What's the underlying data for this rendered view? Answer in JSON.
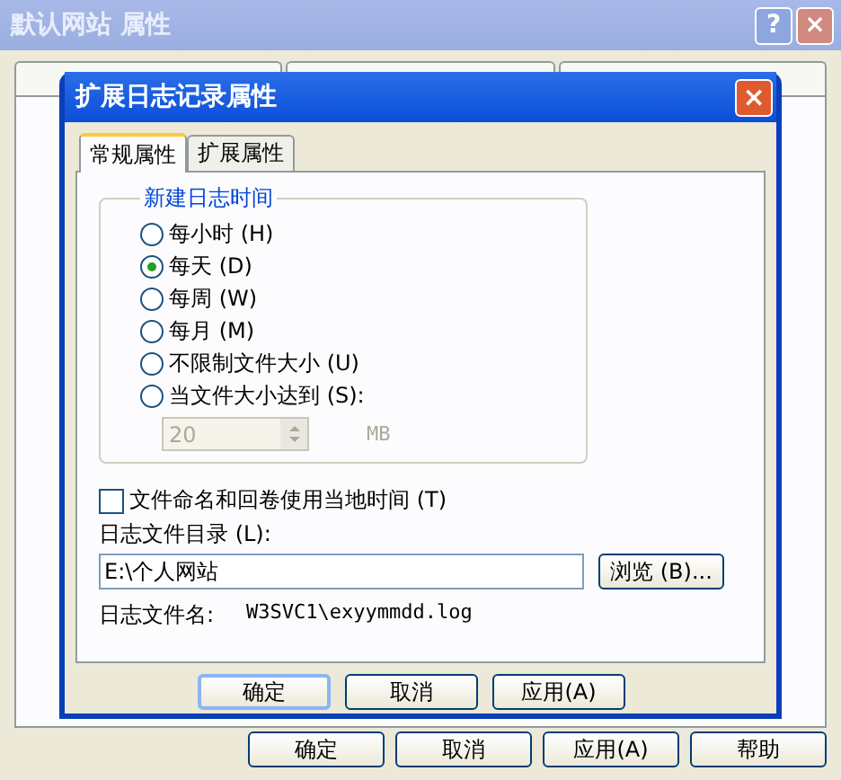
{
  "window": {
    "title": "默认网站 属性"
  },
  "window_buttons": [
    "?",
    "×"
  ],
  "window_buttons_bottom": [
    "确定",
    "取消",
    "应用(A)",
    "帮助"
  ],
  "dialog": {
    "title": "扩展日志记录属性",
    "close": "×",
    "tabs": [
      {
        "label": "常规属性",
        "selected": true
      },
      {
        "label": "扩展属性",
        "selected": false
      }
    ],
    "group": {
      "title": "新建日志时间",
      "options": [
        {
          "label": "每小时 (H)",
          "selected": false
        },
        {
          "label": "每天 (D)",
          "selected": true
        },
        {
          "label": "每周 (W)",
          "selected": false
        },
        {
          "label": "每月 (M)",
          "selected": false
        },
        {
          "label": "不限制文件大小 (U)",
          "selected": false
        },
        {
          "label": "当文件大小达到 (S):",
          "selected": false
        }
      ],
      "size": {
        "value": "20",
        "unit": "MB",
        "disabled": true
      }
    },
    "local_time": {
      "label": "文件命名和回卷使用当地时间 (T)",
      "checked": false
    },
    "dir_label": "日志文件目录 (L):",
    "dir_value": "E:\\个人网站",
    "browse": "浏览 (B)...",
    "file_label": "日志文件名:",
    "file_value": "W3SVC1\\exyymmdd.log",
    "buttons": [
      "确定",
      "取消",
      "应用(A)"
    ]
  }
}
